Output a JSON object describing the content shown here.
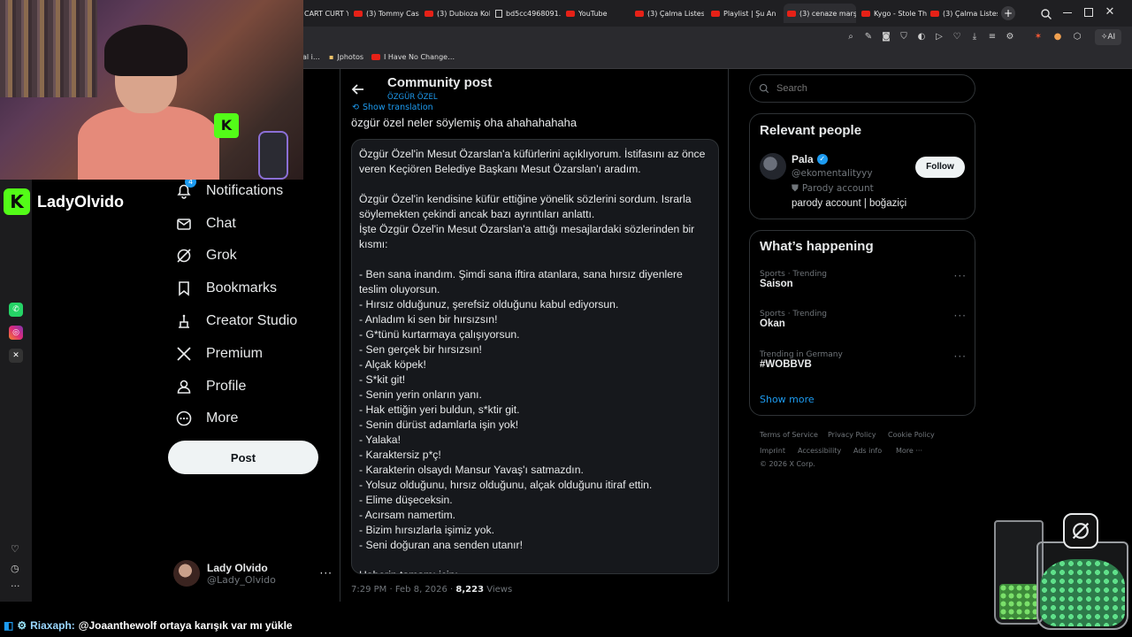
{
  "browser": {
    "tabs": [
      {
        "label": "CART CURT Y",
        "icon": "page-icon"
      },
      {
        "label": "(3) Tommy Cash",
        "icon": "youtube-icon"
      },
      {
        "label": "(3) Dubioza Kole",
        "icon": "youtube-icon"
      },
      {
        "label": "bd5cc4968091…",
        "icon": "page-icon"
      },
      {
        "label": "YouTube",
        "icon": "youtube-icon"
      },
      {
        "label": "(3) Çalma Listesi",
        "icon": "youtube-icon"
      },
      {
        "label": "Playlist | Şu An İç",
        "icon": "youtube-icon"
      },
      {
        "label": "(3) cenaze marşı",
        "icon": "youtube-icon"
      },
      {
        "label": "Kygo - Stole The",
        "icon": "youtube-icon"
      },
      {
        "label": "(3) Çalma Listesi",
        "icon": "youtube-icon"
      }
    ],
    "new_tab": "+",
    "ai_label": "AI",
    "bookmarks": [
      {
        "label": "al i…"
      },
      {
        "label": "Jphotos"
      },
      {
        "label": "I Have No Change…"
      }
    ]
  },
  "stream": {
    "channel_name": "LadyOlvido",
    "chat_user": "Riaxaph:",
    "chat_message": "@Joaanthewolf ortaya karışık var mı yükle"
  },
  "sidebar": {
    "notifications_badge": "4",
    "items": [
      {
        "label": "Notifications",
        "icon": "bell-icon"
      },
      {
        "label": "Chat",
        "icon": "mail-icon"
      },
      {
        "label": "Grok",
        "icon": "grok-icon"
      },
      {
        "label": "Bookmarks",
        "icon": "bookmark-icon"
      },
      {
        "label": "Creator Studio",
        "icon": "creator-studio-icon"
      },
      {
        "label": "Premium",
        "icon": "x-logo-icon"
      },
      {
        "label": "Profile",
        "icon": "person-icon"
      },
      {
        "label": "More",
        "icon": "more-circle-icon"
      }
    ],
    "post_button": "Post",
    "account": {
      "name": "Lady Olvido",
      "handle": "@Lady_Olvido"
    }
  },
  "header": {
    "title": "Community post",
    "subtitle": "ÖZGÜR ÖZEL"
  },
  "post": {
    "show_translation": "Show translation",
    "caption": "özgür özel neler söylemiş oha ahahahahaha",
    "body": "Özgür Özel'in Mesut Özarslan'a küfürlerini açıklıyorum. İstifasını az önce veren Keçiören Belediye Başkanı Mesut Özarslan'ı aradım.\n\nÖzgür Özel'in kendisine küfür ettiğine yönelik sözlerini sordum. Israrla söylemekten çekindi ancak bazı ayrıntıları anlattı.\nİşte Özgür Özel'in Mesut Özarslan'a attığı mesajlardaki sözlerinden bir kısmı:\n\n- Ben sana inandım. Şimdi sana iftira atanlara, sana hırsız diyenlere teslim oluyorsun.\n- Hırsız olduğunuz, şerefsiz olduğunu kabul ediyorsun.\n- Anladım ki sen bir hırsızsın!\n- G*tünü kurtarmaya çalışıyorsun.\n- Sen gerçek bir hırsızsın!\n- Alçak köpek!\n- S*kit git!\n- Senin yerin onların yanı.\n- Hak ettiğin yeri buldun, s*ktir git.\n- Senin dürüst adamlarla işin yok!\n- Yalaka!\n- Karaktersiz p*ç!\n- Karakterin olsaydı Mansur Yavaş'ı satmazdın.\n- Yolsuz olduğunu, hırsız olduğunu, alçak olduğunu itiraf ettin.\n- Elime düşeceksin.\n- Acırsam namertim.\n- Bizim hırsızlarla işimiz yok.\n- Seni doğuran ana senden utanır!\n\nHaberin tamamı için:",
    "timestamp": "7:29 PM · Feb 8, 2026 · ",
    "views_count": "8,223",
    "views_label": " Views"
  },
  "search": {
    "placeholder": "Search"
  },
  "relevant": {
    "title": "Relevant people",
    "name": "Pala",
    "handle": "@ekomentalityyy",
    "parody_label": "Parody account",
    "bio": "parody account | boğaziçi",
    "follow": "Follow"
  },
  "happening": {
    "title": "What’s happening",
    "trends": [
      {
        "meta": "Sports · Trending",
        "name": "Saison"
      },
      {
        "meta": "Sports · Trending",
        "name": "Okan"
      },
      {
        "meta": "Trending in Germany",
        "name": "#WOBBVB"
      }
    ],
    "show_more": "Show more"
  },
  "footer": {
    "links": [
      "Terms of Service",
      "Privacy Policy",
      "Cookie Policy",
      "Imprint",
      "Accessibility",
      "Ads info",
      "More ···"
    ],
    "copyright": "© 2026 X Corp."
  },
  "colors": {
    "accent": "#1d9bf0",
    "kick": "#53fc18",
    "verified": "#1d9bf0"
  }
}
